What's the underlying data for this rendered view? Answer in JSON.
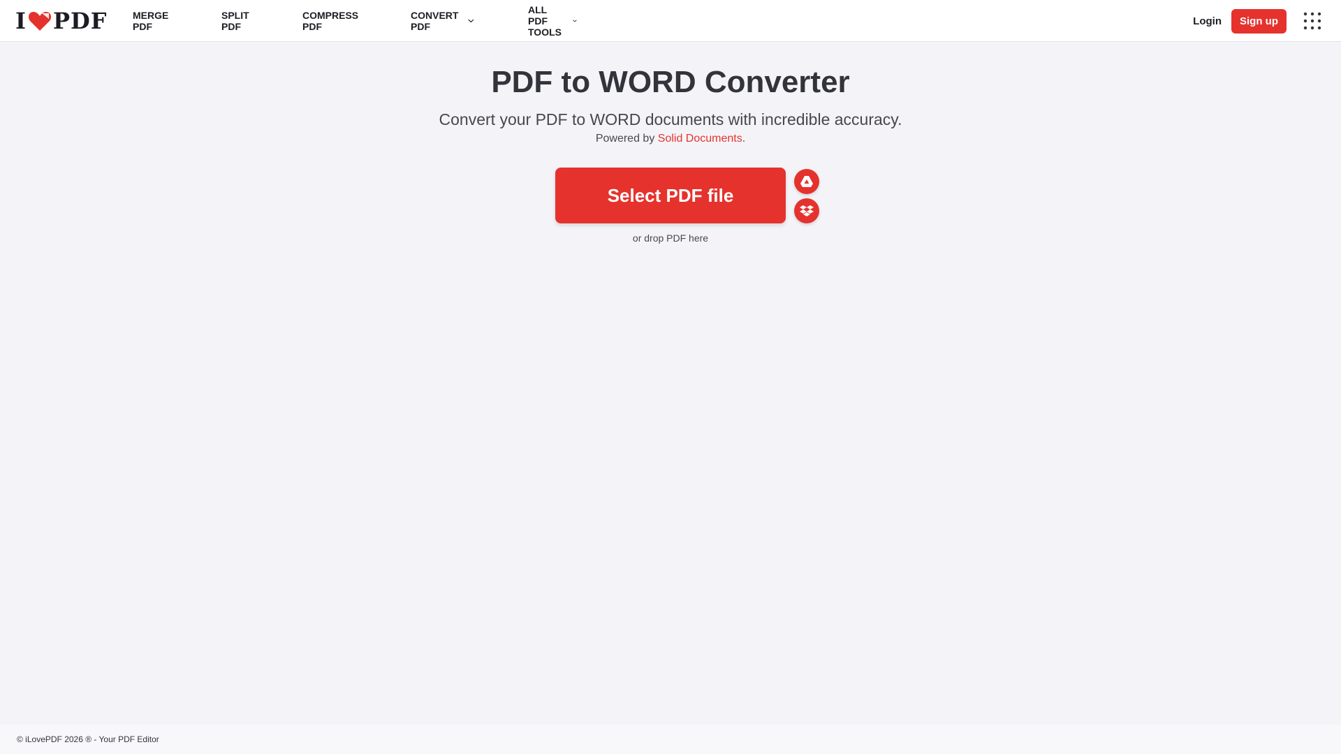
{
  "brand": {
    "logo_left": "I",
    "logo_right": "PDF",
    "accent_color": "#e5322d"
  },
  "nav": {
    "items": [
      {
        "label": "MERGE PDF",
        "dropdown": false
      },
      {
        "label": "SPLIT PDF",
        "dropdown": false
      },
      {
        "label": "COMPRESS PDF",
        "dropdown": false
      },
      {
        "label": "CONVERT PDF",
        "dropdown": true
      },
      {
        "label": "ALL PDF TOOLS",
        "dropdown": true
      }
    ],
    "login_label": "Login",
    "signup_label": "Sign up",
    "apps_icon": "grid-apps-icon"
  },
  "hero": {
    "title": "PDF to WORD Converter",
    "subtitle": "Convert your PDF to WORD documents with incredible accuracy.",
    "powered_prefix": "Powered by ",
    "powered_link": "Solid Documents",
    "powered_suffix": "."
  },
  "upload": {
    "button_label": "Select PDF file",
    "cloud_icons": [
      "google-drive-icon",
      "dropbox-icon"
    ],
    "drop_hint": "or drop PDF here"
  },
  "footer": {
    "text": "© iLovePDF 2026 ® - Your PDF Editor"
  }
}
